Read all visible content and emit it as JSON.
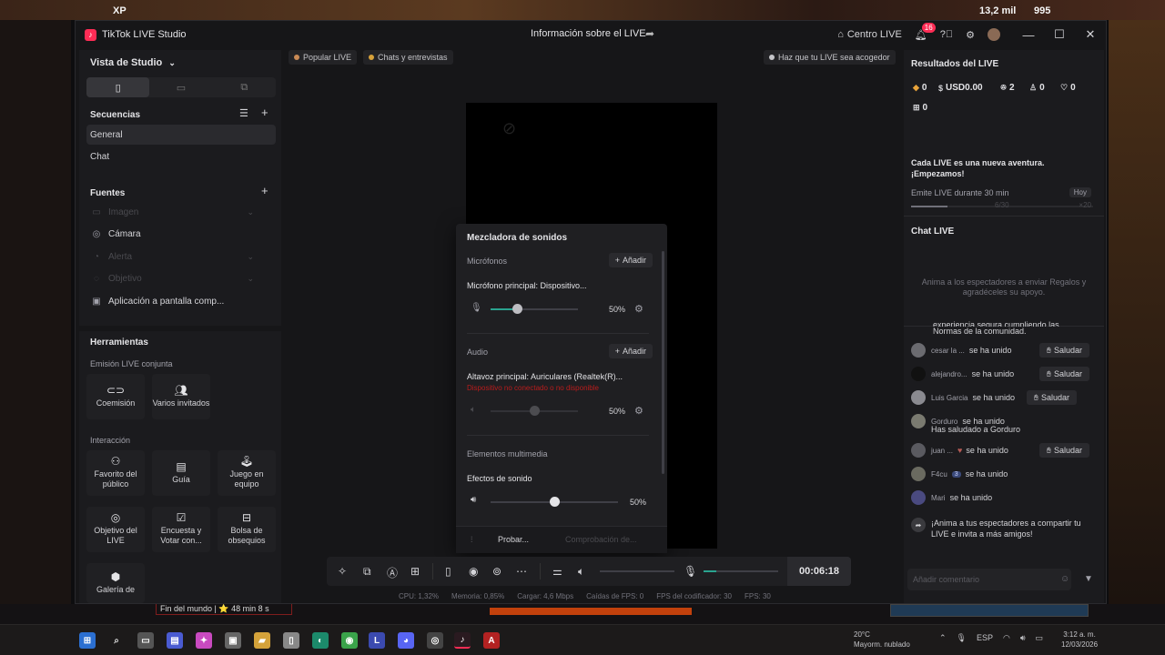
{
  "desktop": {
    "badge_left": "XP",
    "badge_right1": "13,2 mil",
    "badge_right2": "995",
    "chip_text": "Fin del mundo | ⭐ 48 min 8 s"
  },
  "window": {
    "app_title": "TikTok LIVE Studio",
    "center_title": "Información sobre el LIVE",
    "centro_live": "Centro LIVE",
    "notif_count": "16",
    "controls": {
      "minimize": "—",
      "maximize": "☐",
      "close": "✕"
    }
  },
  "left": {
    "studio_view": "Vista de Studio",
    "sequences_title": "Secuencias",
    "sequences": [
      "General",
      "Chat"
    ],
    "sources_title": "Fuentes",
    "sources": [
      {
        "label": "Imagen",
        "icon": "image-icon",
        "glyph": "▭",
        "dim": true
      },
      {
        "label": "Cámara",
        "icon": "camera-icon",
        "glyph": "◎",
        "dim": false
      },
      {
        "label": "Alerta",
        "icon": "bell-icon",
        "glyph": "◔",
        "dim": true
      },
      {
        "label": "Objetivo",
        "icon": "target-icon",
        "glyph": "◌",
        "dim": true
      },
      {
        "label": "Aplicación a pantalla comp...",
        "icon": "screen-icon",
        "glyph": "▣",
        "dim": false
      }
    ],
    "tools_title": "Herramientas",
    "joint_title": "Emisión LIVE conjunta",
    "joint_tools": [
      "Coemisión",
      "Varios invitados"
    ],
    "interaction_title": "Interacción",
    "interaction_tools": [
      "Favorito del público",
      "Guía",
      "Juego en equipo",
      "Objetivo del LIVE",
      "Encuesta y Votar con...",
      "Bolsa de obsequios",
      "Galería de"
    ]
  },
  "center": {
    "chips": [
      "Popular LIVE",
      "Chats y entrevistas"
    ],
    "promo": "Haz que tu LIVE sea acogedor",
    "mixer": {
      "title": "Mezcladora de sonidos",
      "mics_label": "Micrófonos",
      "add": "Añadir",
      "mic_name": "Micrófono principal: Dispositivo...",
      "mic_pct": "50%",
      "mic_level": 50,
      "audio_label": "Audio",
      "speaker_name": "Altavoz principal: Auriculares (Realtek(R)...",
      "speaker_error": "Dispositivo no conectado o no disponible",
      "speaker_pct": "50%",
      "speaker_level": 50,
      "media_label": "Elementos multimedia",
      "sfx_label": "Efectos de sonido",
      "sfx_pct": "50%",
      "sfx_level": 50,
      "test": "Probar...",
      "check": "Comprobación de..."
    },
    "timer": "00:06:18",
    "stats": [
      "CPU: 1,32%",
      "Memoria: 0,85%",
      "Cargar: 4,6 Mbps",
      "Caídas de FPS: 0",
      "FPS del codificador: 30",
      "FPS: 30"
    ]
  },
  "right": {
    "results_title": "Resultados del LIVE",
    "stats": [
      {
        "icon": "diamond-icon",
        "glyph": "◆",
        "value": "0"
      },
      {
        "icon": "dollar-icon",
        "glyph": "$",
        "value": "USD0.00"
      },
      {
        "icon": "users-icon",
        "glyph": "ꔮ",
        "value": "2"
      },
      {
        "icon": "user-plus-icon",
        "glyph": "♙",
        "value": "0"
      },
      {
        "icon": "heart-icon",
        "glyph": "♡",
        "value": "0"
      },
      {
        "icon": "gift-icon",
        "glyph": "⊞",
        "value": "0"
      }
    ],
    "adventure": "Cada LIVE es una nueva aventura. ¡Empezamos!",
    "goal": "Emite LIVE durante 30 min",
    "goal_badge": "Hoy",
    "goal_progress": "6/30",
    "goal_reward": "×20",
    "goal_fraction": 0.2,
    "chat_title": "Chat LIVE",
    "chat_hint": "Anima a los espectadores a enviar Regalos y agradéceles su apoyo.",
    "rules_tail": "Normas de la comunidad.",
    "rules_head": "experiencia segura cumpliendo las",
    "messages": [
      {
        "user": "cesar la ...",
        "text": "se ha unido",
        "greet": "Saludar"
      },
      {
        "user": "alejandro...",
        "text": "se ha unido",
        "greet": "Saludar"
      },
      {
        "user": "Luis Garcia",
        "text": "se ha unido",
        "greet": "Saludar"
      },
      {
        "user": "Gorduro",
        "text": "se ha unido",
        "greet": ""
      },
      {
        "user": "juan ...",
        "text": "se ha unido",
        "greet": "Saludar"
      },
      {
        "user": "F4cu",
        "text": "se ha unido",
        "greet": "",
        "pill": "3"
      },
      {
        "user": "Mari",
        "text": "se ha unido",
        "greet": ""
      }
    ],
    "greeted": "Has saludado a Gorduro",
    "share_hint": "¡Anima a tus espectadores a compartir tu LIVE e invita a más amigos!",
    "comment_placeholder": "Añadir comentario"
  },
  "taskbar": {
    "temp": "20°C",
    "weather": "Mayorm. nublado",
    "lang": "ESP",
    "time": "3:12 a. m.",
    "date": "12/03/2026"
  }
}
